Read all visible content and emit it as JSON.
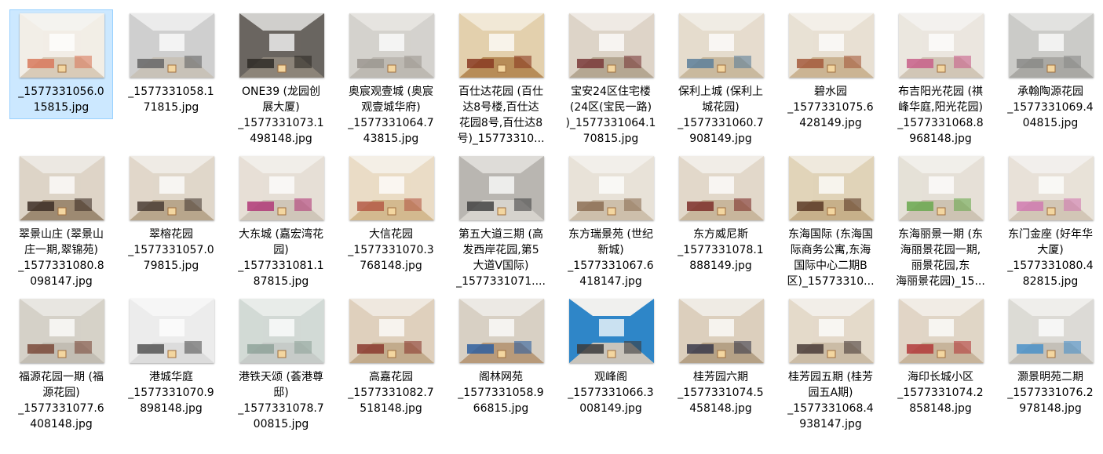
{
  "files": [
    {
      "lines": [
        "_1577331056.0",
        "15815.jpg"
      ],
      "room": {
        "ceiling": "#f4f3ef",
        "wall": "#f2ede6",
        "floor": "#d9cbb8",
        "accent": "#d8795c"
      }
    },
    {
      "lines": [
        "_1577331058.1",
        "71815.jpg"
      ],
      "room": {
        "ceiling": "#ebebeb",
        "wall": "#cfcfcf",
        "floor": "#c8c2b8",
        "accent": "#666666"
      }
    },
    {
      "lines": [
        "ONE39 (龙园创",
        "展大厦)",
        "_1577331073.1",
        "498148.jpg"
      ],
      "room": {
        "ceiling": "#d0cfcc",
        "wall": "#6a6560",
        "floor": "#8c8479",
        "accent": "#2f2b27"
      }
    },
    {
      "lines": [
        "奥宸观壹城 (奥宸",
        "观壹城华府)",
        "_1577331064.7",
        "43815.jpg"
      ],
      "room": {
        "ceiling": "#e6e4e0",
        "wall": "#d4d2cd",
        "floor": "#bdb9b2",
        "accent": "#9c9891"
      }
    },
    {
      "lines": [
        "百仕达花园 (百仕",
        "达8号楼,百仕达",
        "花园8号,百仕达8",
        "号)_15773310..."
      ],
      "room": {
        "ceiling": "#f1e8d6",
        "wall": "#e3d0ad",
        "floor": "#b78c58",
        "accent": "#8a3b22"
      }
    },
    {
      "lines": [
        "宝安24区住宅楼",
        "(24区(宝民一路)",
        ")_1577331064.1",
        "70815.jpg"
      ],
      "room": {
        "ceiling": "#efeae4",
        "wall": "#ddd4c8",
        "floor": "#b5a792",
        "accent": "#7a3a3a"
      }
    },
    {
      "lines": [
        "保利上城 (保利上",
        "城花园)",
        "_1577331060.7",
        "908149.jpg"
      ],
      "room": {
        "ceiling": "#f0ece4",
        "wall": "#e5dccd",
        "floor": "#c9b99e",
        "accent": "#5d7f9a"
      }
    },
    {
      "lines": [
        "碧水园",
        "_1577331075.6",
        "428149.jpg"
      ],
      "room": {
        "ceiling": "#f3efe8",
        "wall": "#e8e0d3",
        "floor": "#cbb493",
        "accent": "#a55a3c"
      }
    },
    {
      "lines": [
        "布吉阳光花园 (祺",
        "峰华庭,阳光花园)",
        "_1577331068.8",
        "968148.jpg"
      ],
      "room": {
        "ceiling": "#f3f1ee",
        "wall": "#ebe6df",
        "floor": "#d1c6b6",
        "accent": "#c85f8a"
      }
    },
    {
      "lines": [
        "承翰陶源花园",
        "_1577331069.4",
        "04815.jpg"
      ],
      "room": {
        "ceiling": "#e2e2e0",
        "wall": "#cbcbc8",
        "floor": "#a9a8a4",
        "accent": "#8b8b88"
      }
    },
    {
      "lines": [
        "翠景山庄 (翠景山",
        "庄一期,翠锦苑)",
        "_1577331080.8",
        "098147.jpg"
      ],
      "room": {
        "ceiling": "#ece8e2",
        "wall": "#ddd4c7",
        "floor": "#9d8a72",
        "accent": "#3d2e26"
      }
    },
    {
      "lines": [
        "翠榕花园",
        "_1577331057.0",
        "79815.jpg"
      ],
      "room": {
        "ceiling": "#efebe5",
        "wall": "#e0d7ca",
        "floor": "#b8a68c",
        "accent": "#4a3d35"
      }
    },
    {
      "lines": [
        "大东城 (嘉宏湾花",
        "园)",
        "_1577331081.1",
        "87815.jpg"
      ],
      "room": {
        "ceiling": "#f1eee9",
        "wall": "#e6dfd6",
        "floor": "#cfc6b9",
        "accent": "#b03a78"
      }
    },
    {
      "lines": [
        "大信花园",
        "_1577331070.3",
        "768148.jpg"
      ],
      "room": {
        "ceiling": "#f4efe6",
        "wall": "#eadcc5",
        "floor": "#d3b98f",
        "accent": "#b45a46"
      }
    },
    {
      "lines": [
        "第五大道三期 (高",
        "发西岸花园,第5",
        "大道V国际)",
        "_1577331071...."
      ],
      "room": {
        "ceiling": "#dedcd8",
        "wall": "#b9b6b1",
        "floor": "#d6d3cd",
        "accent": "#444444"
      }
    },
    {
      "lines": [
        "东方瑞景苑 (世纪",
        "新城)",
        "_1577331067.6",
        "418147.jpg"
      ],
      "room": {
        "ceiling": "#f2efea",
        "wall": "#e8e2d8",
        "floor": "#cdbfab",
        "accent": "#8c6f55"
      }
    },
    {
      "lines": [
        "东方威尼斯",
        "_1577331078.1",
        "888149.jpg"
      ],
      "room": {
        "ceiling": "#f1ede7",
        "wall": "#e2d8ca",
        "floor": "#c8b69c",
        "accent": "#7d2f2a"
      }
    },
    {
      "lines": [
        "东海国际 (东海国",
        "际商务公寓,东海",
        "国际中心二期B",
        "区)_15773310..."
      ],
      "room": {
        "ceiling": "#efe9dd",
        "wall": "#e0d3b8",
        "floor": "#c7b08a",
        "accent": "#5b3a26"
      }
    },
    {
      "lines": [
        "东海丽景一期 (东",
        "海丽景花园一期,",
        "丽景花园,东",
        "海丽景花园)_15..."
      ],
      "room": {
        "ceiling": "#f1efea",
        "wall": "#e5e0d7",
        "floor": "#cdc3b3",
        "accent": "#6aa84f"
      }
    },
    {
      "lines": [
        "东门金座 (好年华",
        "大厦)",
        "_1577331080.4",
        "82815.jpg"
      ],
      "room": {
        "ceiling": "#f2efec",
        "wall": "#e8e1d8",
        "floor": "#d2c6b6",
        "accent": "#d07ab0"
      }
    },
    {
      "lines": [
        "福源花园一期 (福",
        "源花园)",
        "_1577331077.6",
        "408148.jpg"
      ],
      "room": {
        "ceiling": "#e8e6e1",
        "wall": "#d5d1c8",
        "floor": "#c2bdb3",
        "accent": "#7a4a3a"
      }
    },
    {
      "lines": [
        "港城华庭",
        "_1577331070.9",
        "898148.jpg"
      ],
      "room": {
        "ceiling": "#f6f6f6",
        "wall": "#ececec",
        "floor": "#dcdcdc",
        "accent": "#555555"
      }
    },
    {
      "lines": [
        "港铁天颂 (荟港尊",
        "邸)",
        "_1577331078.7",
        "00815.jpg"
      ],
      "room": {
        "ceiling": "#e8ece9",
        "wall": "#d2d9d5",
        "floor": "#c6cbc8",
        "accent": "#8fa39a"
      }
    },
    {
      "lines": [
        "高嘉花园",
        "_1577331082.7",
        "518148.jpg"
      ],
      "room": {
        "ceiling": "#efe8df",
        "wall": "#dfd0bd",
        "floor": "#c2ab8c",
        "accent": "#8b3a2f"
      }
    },
    {
      "lines": [
        "阁林网苑",
        "_1577331058.9",
        "66815.jpg"
      ],
      "room": {
        "ceiling": "#ece9e4",
        "wall": "#d8d0c4",
        "floor": "#b89a7a",
        "accent": "#2f5f9f"
      }
    },
    {
      "lines": [
        "观峰阁",
        "_1577331066.3",
        "008149.jpg"
      ],
      "room": {
        "ceiling": "#f0f0ee",
        "wall": "#2f86c8",
        "floor": "#c9c4bb",
        "accent": "#3b3b3b"
      }
    },
    {
      "lines": [
        "桂芳园六期",
        "_1577331074.5",
        "458148.jpg"
      ],
      "room": {
        "ceiling": "#efebe4",
        "wall": "#dccfbd",
        "floor": "#b5a186",
        "accent": "#3a3a4a"
      }
    },
    {
      "lines": [
        "桂芳园五期 (桂芳",
        "园五A期)",
        "_1577331068.4",
        "938147.jpg"
      ],
      "room": {
        "ceiling": "#f2eee8",
        "wall": "#e4d9ca",
        "floor": "#cbbca6",
        "accent": "#4a3c38"
      }
    },
    {
      "lines": [
        "海印长城小区",
        "_1577331074.2",
        "858148.jpg"
      ],
      "room": {
        "ceiling": "#f1ece5",
        "wall": "#e0d5c6",
        "floor": "#c7b49b",
        "accent": "#b23a3a"
      }
    },
    {
      "lines": [
        "灏景明苑二期",
        "_1577331076.2",
        "978148.jpg"
      ],
      "room": {
        "ceiling": "#efeeeb",
        "wall": "#dcdad5",
        "floor": "#c4c0b8",
        "accent": "#4a90c8"
      }
    }
  ]
}
